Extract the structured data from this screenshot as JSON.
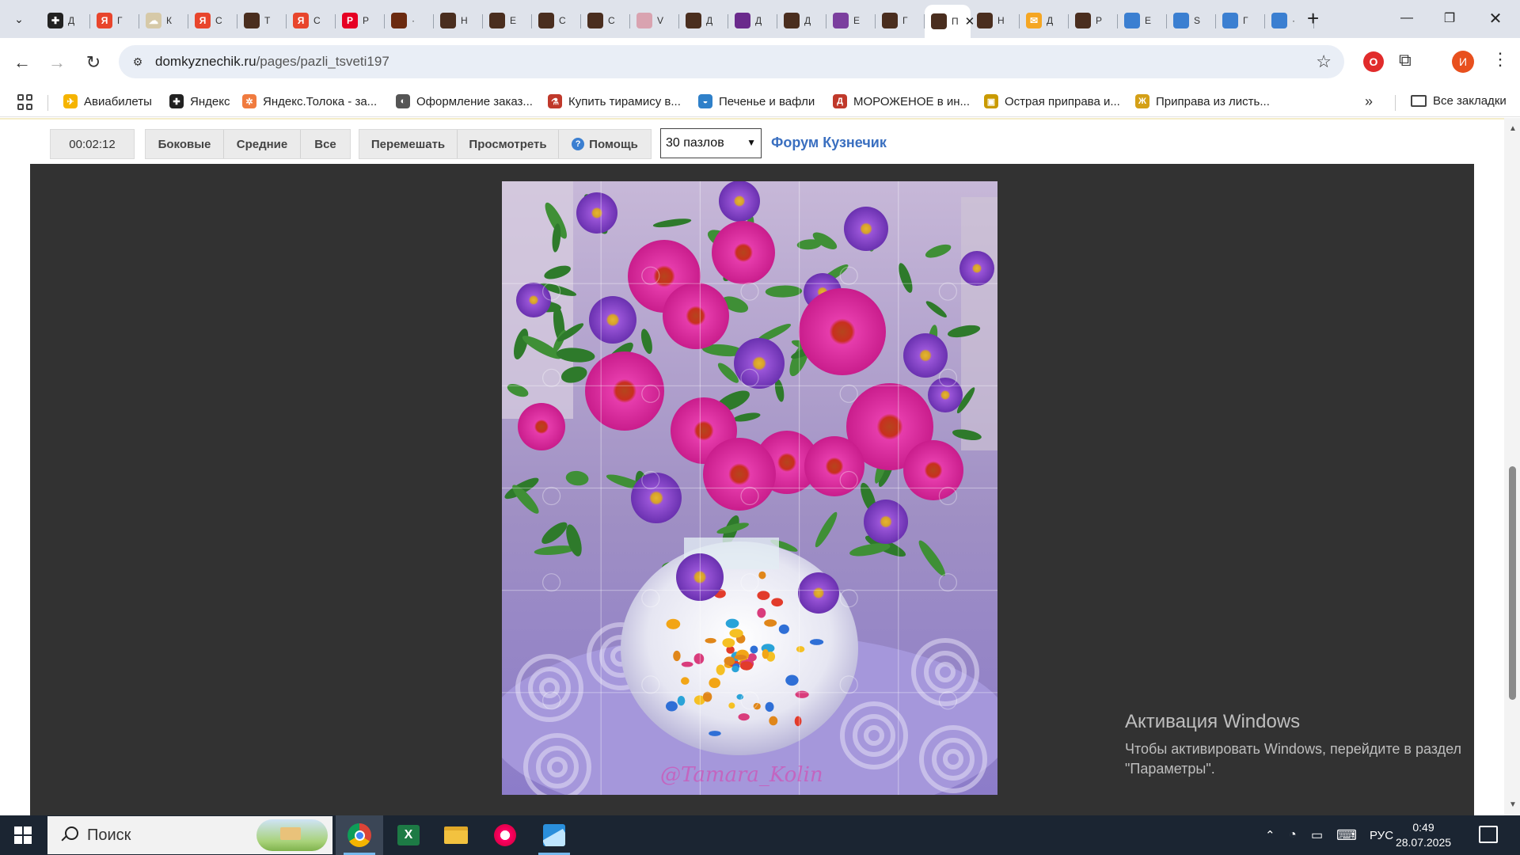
{
  "browser": {
    "tabs": [
      {
        "ch": "Д",
        "color": "#222222",
        "glyph": "✚"
      },
      {
        "ch": "Г",
        "color": "#e8452c",
        "glyph": "Я"
      },
      {
        "ch": "К",
        "color": "#d6c9a8",
        "glyph": "☁"
      },
      {
        "ch": "С",
        "color": "#e8452c",
        "glyph": "Я"
      },
      {
        "ch": "Т",
        "color": "#4a2e1f",
        "glyph": ""
      },
      {
        "ch": "С",
        "color": "#e8452c",
        "glyph": "Я"
      },
      {
        "ch": "Р",
        "color": "#e60023",
        "glyph": "P"
      },
      {
        "ch": "·",
        "color": "#6b2a10",
        "glyph": ""
      },
      {
        "ch": "Н",
        "color": "#4a2e1f",
        "glyph": ""
      },
      {
        "ch": "Е",
        "color": "#4a2e1f",
        "glyph": ""
      },
      {
        "ch": "С",
        "color": "#4a2e1f",
        "glyph": ""
      },
      {
        "ch": "С",
        "color": "#4a2e1f",
        "glyph": ""
      },
      {
        "ch": "V",
        "color": "#d9a3b0",
        "glyph": ""
      },
      {
        "ch": "Д",
        "color": "#4a2e1f",
        "glyph": ""
      },
      {
        "ch": "Д",
        "color": "#6a2a8c",
        "glyph": ""
      },
      {
        "ch": "Д",
        "color": "#4a2e1f",
        "glyph": ""
      },
      {
        "ch": "Е",
        "color": "#7b3f9e",
        "glyph": ""
      },
      {
        "ch": "Г",
        "color": "#4a2e1f",
        "glyph": ""
      },
      {
        "ch": "П",
        "color": "#4a2e1f",
        "glyph": "",
        "active": true
      },
      {
        "ch": "Н",
        "color": "#4a2e1f",
        "glyph": ""
      },
      {
        "ch": "Д",
        "color": "#f5a623",
        "glyph": "✉"
      },
      {
        "ch": "Р",
        "color": "#4a2e1f",
        "glyph": ""
      },
      {
        "ch": "Е",
        "color": "#3b7fd1",
        "glyph": ""
      },
      {
        "ch": "S",
        "color": "#3b7fd1",
        "glyph": ""
      },
      {
        "ch": "Г",
        "color": "#3b7fd1",
        "glyph": ""
      },
      {
        "ch": "·",
        "color": "#3b7fd1",
        "glyph": ""
      }
    ],
    "url_domain": "domkyznechik.ru",
    "url_path": "/pages/pazli_tsveti197",
    "profile_initial": "И",
    "bookmarks": [
      {
        "label": "Авиабилеты",
        "color": "#f5b400",
        "glyph": "✈"
      },
      {
        "label": "Яндекс",
        "color": "#222222",
        "glyph": "✚"
      },
      {
        "label": "Яндекс.Толока - за...",
        "color": "#f07b3f",
        "glyph": "✲"
      },
      {
        "label": "Оформление заказ...",
        "color": "#555555",
        "glyph": "◐"
      },
      {
        "label": "Купить тирамису в...",
        "color": "#c0392b",
        "glyph": "⚗"
      },
      {
        "label": "Печенье и вафли",
        "color": "#2f80c9",
        "glyph": "◒"
      },
      {
        "label": "МОРОЖЕНОЕ в ин...",
        "color": "#c0392b",
        "glyph": "Д"
      },
      {
        "label": "Острая приправа и...",
        "color": "#c99a00",
        "glyph": "▣"
      },
      {
        "label": "Приправа из листь...",
        "color": "#d4a017",
        "glyph": "Ж"
      }
    ],
    "all_bookmarks_label": "Все закладки"
  },
  "puzzle": {
    "timer": "00:02:12",
    "filter_buttons": [
      "Боковые",
      "Средние",
      "Все"
    ],
    "action_buttons": [
      "Перемешать",
      "Просмотреть",
      "Помощь"
    ],
    "pieces_select": "30 пазлов",
    "forum_link": "Форум Кузнечик",
    "rows": 6,
    "cols": 5,
    "watermark": "@Tamara_Kolin"
  },
  "windows_activation": {
    "title": "Активация Windows",
    "line1": "Чтобы активировать Windows, перейдите в раздел",
    "line2": "\"Параметры\"."
  },
  "taskbar": {
    "search_placeholder": "Поиск",
    "language": "РУС",
    "time": "0:49",
    "date": "28.07.2025"
  }
}
